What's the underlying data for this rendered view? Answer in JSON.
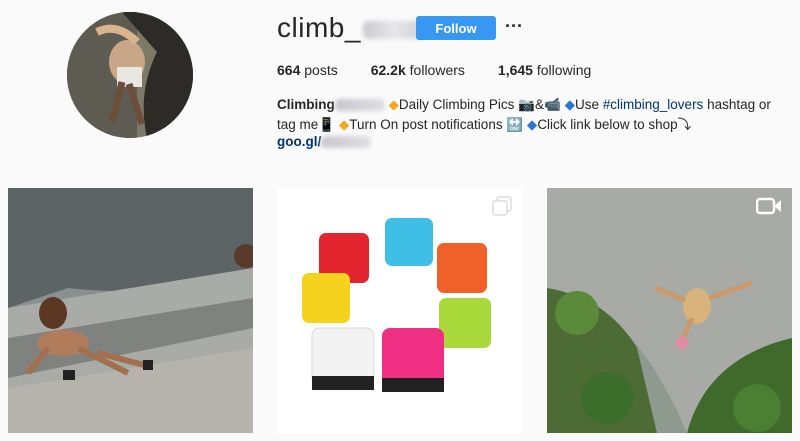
{
  "profile": {
    "username": "climb_",
    "follow_label": "Follow",
    "more_label": "···",
    "stats": [
      {
        "value": "664",
        "label": "posts"
      },
      {
        "value": "62.2k",
        "label": "followers"
      },
      {
        "value": "1,645",
        "label": "following"
      }
    ],
    "bio": {
      "name": "Climbing",
      "line1_part1": "Daily Climbing Pics",
      "line1_emoji1": "📷&📹",
      "line1_part2": "Use",
      "hashtag": "#climbing_lovers",
      "line1_part3": "hashtag or",
      "line2_part1": "tag me",
      "line2_emoji": "📱",
      "line2_part2": "Turn On post notifications",
      "line2_emoji2": "🔛",
      "line2_part3": "Click link below to shop",
      "line2_arrow": "⤵"
    },
    "link": "goo.gl/"
  },
  "posts": [
    {
      "kind": "photo",
      "subject": "climber on rock face"
    },
    {
      "kind": "carousel",
      "subject": "colorful travel adapters",
      "icon": "multiple-photos-icon"
    },
    {
      "kind": "video",
      "subject": "aerial view climber",
      "icon": "video-camera-icon"
    }
  ],
  "colors": {
    "accent": "#3897f0",
    "link": "#003569",
    "text": "#262626",
    "background": "#fafafa"
  }
}
